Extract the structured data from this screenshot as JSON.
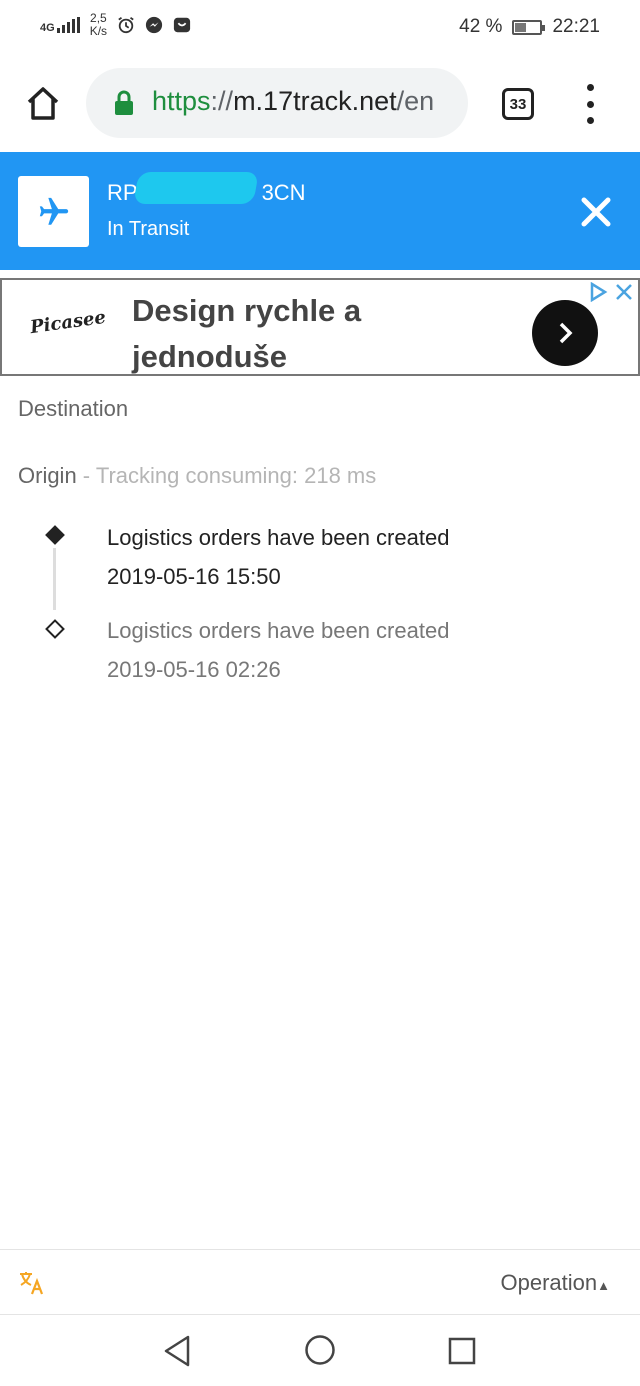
{
  "status_bar": {
    "network": "4G",
    "speed_value": "2,5",
    "speed_unit": "K/s",
    "battery_percent": "42 %",
    "battery_level": 0.42,
    "time": "22:21"
  },
  "browser": {
    "url_scheme": "https",
    "url_separator": "://",
    "url_host": "m.17track.net",
    "url_rest": "/en",
    "tab_count": "33"
  },
  "tracking": {
    "number_prefix": "RP",
    "number_suffix": "3CN",
    "status": "In Transit",
    "colors": {
      "header": "#2196f3"
    }
  },
  "ad": {
    "logo_text": "Picasee",
    "headline_line1": "Design rychle a",
    "headline_line2": "jednoduše"
  },
  "content": {
    "destination_label": "Destination",
    "origin_label": "Origin",
    "separator": " - ",
    "timing_text": "Tracking consuming: 218 ms",
    "events": [
      {
        "description": "Logistics orders have been created",
        "timestamp": "2019-05-16 15:50"
      },
      {
        "description": "Logistics orders have been created",
        "timestamp": "2019-05-16 02:26"
      }
    ]
  },
  "bottom_bar": {
    "operation_label": "Operation",
    "operation_caret": "▲"
  },
  "icons": {
    "translate": "translate-icon",
    "home": "home-icon",
    "lock": "lock-icon",
    "plane": "airplane-icon",
    "close": "close-icon"
  }
}
